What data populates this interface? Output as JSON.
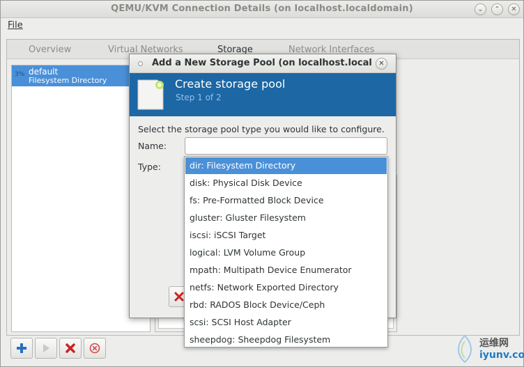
{
  "window": {
    "title": "QEMU/KVM Connection Details (on localhost.localdomain)",
    "menu_file": "File"
  },
  "tabs": [
    {
      "label": "Overview"
    },
    {
      "label": "Virtual Networks"
    },
    {
      "label": "Storage"
    },
    {
      "label": "Network Interfaces"
    }
  ],
  "active_tab": "Storage",
  "pools": [
    {
      "usage": "3%",
      "name": "default",
      "type": "Filesystem Directory"
    }
  ],
  "dialog": {
    "title": "Add a New Storage Pool (on localhost.local",
    "header": "Create storage pool",
    "step": "Step 1 of 2",
    "prompt": "Select the storage pool type you would like to configure.",
    "name_label": "Name:",
    "name_value": "",
    "type_label": "Type:"
  },
  "type_options": [
    "dir: Filesystem Directory",
    "disk: Physical Disk Device",
    "fs: Pre-Formatted Block Device",
    "gluster: Gluster Filesystem",
    "iscsi: iSCSI Target",
    "logical: LVM Volume Group",
    "mpath: Multipath Device Enumerator",
    "netfs: Network Exported Directory",
    "rbd: RADOS Block Device/Ceph",
    "scsi: SCSI Host Adapter",
    "sheepdog: Sheepdog Filesystem"
  ],
  "selected_option_index": 0,
  "toolbar": [
    {
      "icon": "add-icon"
    },
    {
      "icon": "play-icon"
    },
    {
      "icon": "delete-icon"
    },
    {
      "icon": "stop-icon"
    }
  ],
  "watermark": {
    "line1": "运维网",
    "line2": "iyunv.com"
  },
  "colors": {
    "selection": "#4a90d9",
    "banner": "#1c67a4",
    "delete": "#cc2222"
  }
}
